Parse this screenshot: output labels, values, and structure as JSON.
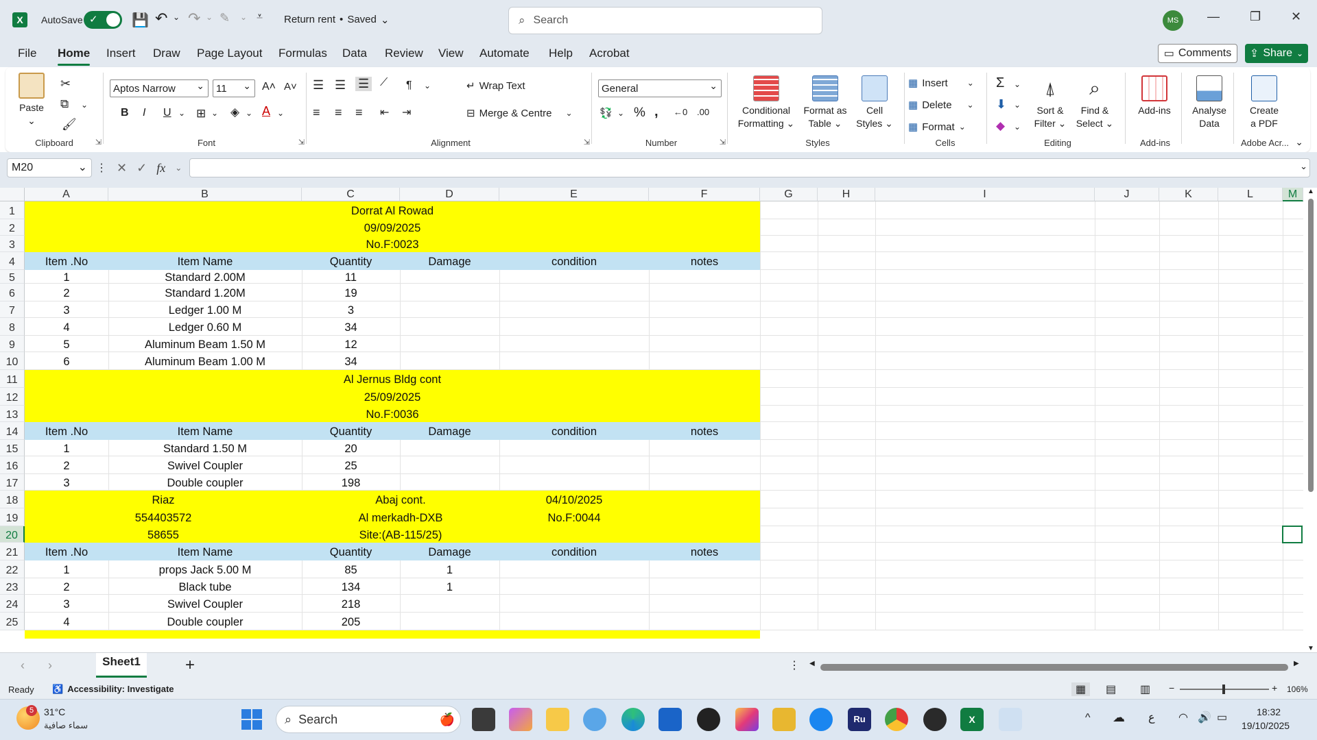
{
  "titlebar": {
    "autosave_label": "AutoSave",
    "doc_title": "Return rent",
    "status": "Saved",
    "search_placeholder": "Search",
    "user_initials": "MS"
  },
  "menu": [
    "File",
    "Home",
    "Insert",
    "Draw",
    "Page Layout",
    "Formulas",
    "Data",
    "Review",
    "View",
    "Automate",
    "Help",
    "Acrobat"
  ],
  "menu_active": "Home",
  "buttons": {
    "comments": "Comments",
    "share": "Share"
  },
  "ribbon": {
    "clipboard": {
      "label": "Clipboard",
      "paste": "Paste"
    },
    "font": {
      "label": "Font",
      "name": "Aptos Narrow",
      "size": "11"
    },
    "alignment": {
      "label": "Alignment",
      "wrap": "Wrap Text",
      "merge": "Merge & Centre"
    },
    "number": {
      "label": "Number",
      "format": "General"
    },
    "styles": {
      "label": "Styles",
      "cond1": "Conditional",
      "cond2": "Formatting",
      "fat1": "Format as",
      "fat2": "Table",
      "cs1": "Cell",
      "cs2": "Styles"
    },
    "cells": {
      "label": "Cells",
      "insert": "Insert",
      "delete": "Delete",
      "format": "Format"
    },
    "editing": {
      "label": "Editing",
      "sort1": "Sort &",
      "sort2": "Filter",
      "find1": "Find &",
      "find2": "Select"
    },
    "addins": {
      "label": "Add-ins",
      "btn": "Add-ins"
    },
    "analyse": {
      "l1": "Analyse",
      "l2": "Data"
    },
    "adobe": {
      "label": "Adobe Acr...",
      "l1": "Create",
      "l2": "a PDF"
    }
  },
  "namebox": "M20",
  "columns": [
    "A",
    "B",
    "C",
    "D",
    "E",
    "F",
    "G",
    "H",
    "I",
    "J",
    "K",
    "L",
    "M"
  ],
  "rows": [
    "1",
    "2",
    "3",
    "4",
    "5",
    "6",
    "7",
    "8",
    "9",
    "10",
    "11",
    "12",
    "13",
    "14",
    "15",
    "16",
    "17",
    "18",
    "19",
    "20",
    "21",
    "22",
    "23",
    "24",
    "25"
  ],
  "sheet": {
    "block1": {
      "title": "Dorrat   Al Rowad",
      "date": "09/09/2025",
      "no": "No.F:0023"
    },
    "headers": [
      "Item .No",
      "Item Name",
      "Quantity",
      "Damage",
      "condition",
      "notes"
    ],
    "block1_rows": [
      [
        "1",
        "Standard  2.00M",
        "11"
      ],
      [
        "2",
        "Standard 1.20M",
        "19"
      ],
      [
        "3",
        "Ledger 1.00 M",
        "3"
      ],
      [
        "4",
        "Ledger 0.60 M",
        "34"
      ],
      [
        "5",
        "Aluminum Beam 1.50 M",
        "12"
      ],
      [
        "6",
        "Aluminum Beam 1.00 M",
        "34"
      ]
    ],
    "block2": {
      "title": "Al Jernus Bldg cont",
      "date": "25/09/2025",
      "no": "No.F:0036"
    },
    "block2_rows": [
      [
        "1",
        "Standard 1.50 M",
        "20"
      ],
      [
        "2",
        "Swivel Coupler",
        "25"
      ],
      [
        "3",
        "Double coupler",
        "198"
      ]
    ],
    "block3": {
      "r18": [
        "Riaz",
        "Abaj cont.",
        "04/10/2025"
      ],
      "r19": [
        "554403572",
        "Al merkadh-DXB",
        "No.F:0044"
      ],
      "r20": [
        "58655",
        "Site:(AB-115/25)"
      ]
    },
    "block3_rows": [
      [
        "1",
        "props Jack  5.00 M",
        "85",
        "1"
      ],
      [
        "2",
        "Black tube",
        "134",
        "1"
      ],
      [
        "3",
        "Swivel Coupler",
        "218",
        ""
      ],
      [
        "4",
        "Double coupler",
        "205",
        ""
      ]
    ]
  },
  "sheet_tab": "Sheet1",
  "status": {
    "ready": "Ready",
    "accessibility": "Accessibility: Investigate",
    "zoom": "106%"
  },
  "taskbar": {
    "weather_temp": "31°C",
    "weather_desc": "سماء صافية",
    "weather_badge": "5",
    "search": "Search",
    "lang": "ع",
    "time": "18:32",
    "date": "19/10/2025"
  },
  "colors": {
    "excel_green": "#107c41",
    "band_yellow": "#ffff00",
    "header_blue": "#c2e2f3"
  }
}
